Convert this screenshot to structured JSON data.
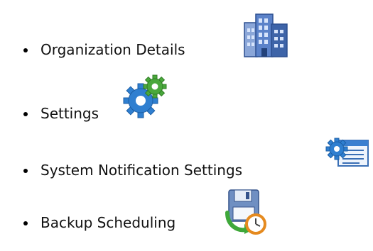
{
  "menu": {
    "items": [
      {
        "label": "Organization Details",
        "icon": "building-icon"
      },
      {
        "label": "Settings",
        "icon": "gears-icon"
      },
      {
        "label": "System Notification Settings",
        "icon": "settings-window-icon"
      },
      {
        "label": "Backup Scheduling",
        "icon": "backup-schedule-icon"
      }
    ]
  },
  "colors": {
    "building_blue": "#4a6fb5",
    "gear_blue": "#2f7fd0",
    "gear_green": "#4aa83c",
    "clock_orange": "#e58a1f"
  }
}
